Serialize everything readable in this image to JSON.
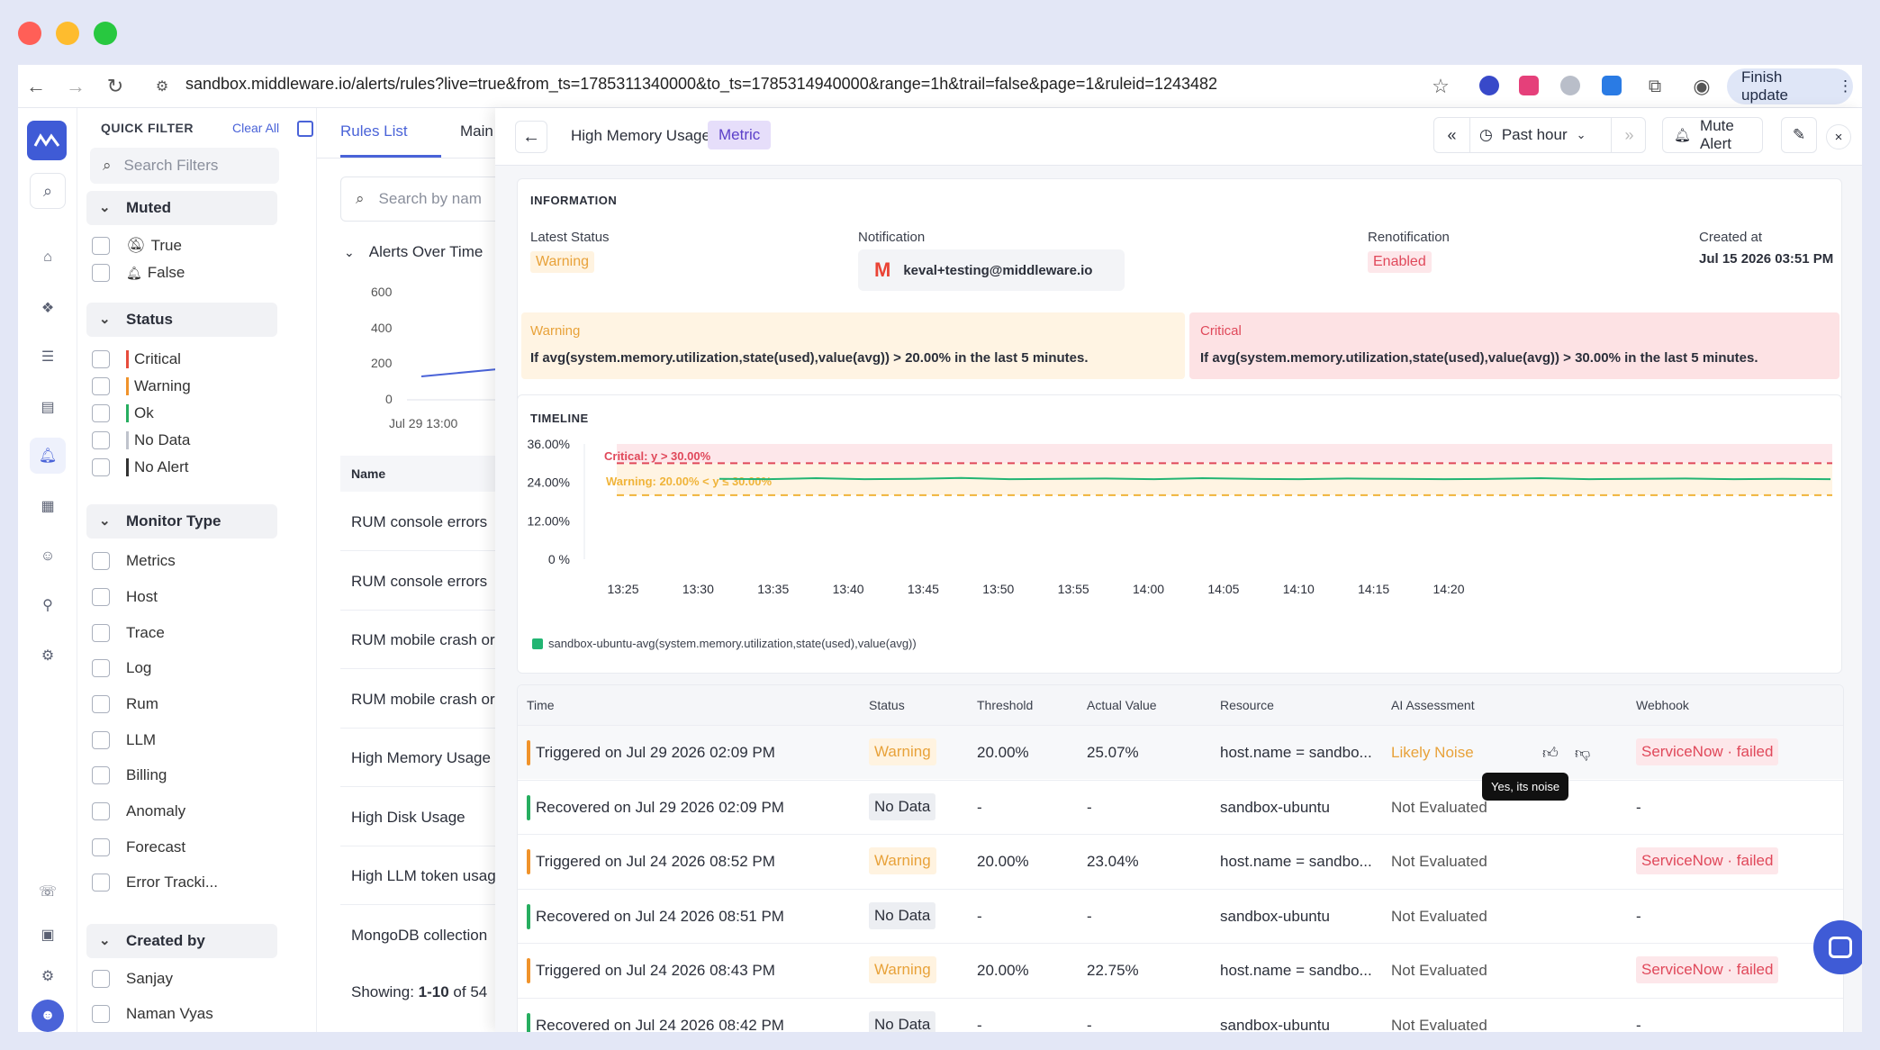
{
  "browser": {
    "url": "sandbox.middleware.io/alerts/rules?live=true&from_ts=1785311340000&to_ts=1785314940000&range=1h&trail=false&page=1&ruleid=1243482",
    "finish_update": "Finish update"
  },
  "quick_filter": {
    "title": "QUICK FILTER",
    "clear_all": "Clear All",
    "search_placeholder": "Search Filters",
    "muted": {
      "title": "Muted",
      "options": [
        "True",
        "False"
      ]
    },
    "status": {
      "title": "Status",
      "options": [
        "Critical",
        "Warning",
        "Ok",
        "No Data",
        "No Alert"
      ]
    },
    "monitor_type": {
      "title": "Monitor Type",
      "options": [
        "Metrics",
        "Host",
        "Trace",
        "Log",
        "Rum",
        "LLM",
        "Billing",
        "Anomaly",
        "Forecast",
        "Error Tracki..."
      ]
    },
    "created_by": {
      "title": "Created by",
      "options": [
        "Sanjay",
        "Naman Vyas"
      ]
    }
  },
  "rules_list": {
    "tabs": [
      "Rules List",
      "Main"
    ],
    "search_placeholder": "Search by nam",
    "alerts_over_time": "Alerts Over Time",
    "y_ticks": [
      "600",
      "400",
      "200",
      "0"
    ],
    "x_tick": "Jul 29 13:00",
    "name_header": "Name",
    "rows": [
      "RUM console errors",
      "RUM console errors",
      "RUM mobile crash or",
      "RUM mobile crash or",
      "High Memory Usage",
      "High Disk Usage",
      "High LLM token usag",
      "MongoDB collection"
    ],
    "showing_prefix": "Showing: ",
    "showing_range": "1-10",
    "showing_suffix": " of 54"
  },
  "detail": {
    "title": "High Memory Usage",
    "type_badge": "Metric",
    "time_range": "Past hour",
    "mute_label": "Mute Alert",
    "info_title": "INFORMATION",
    "latest_status_label": "Latest Status",
    "latest_status": "Warning",
    "notification_label": "Notification",
    "notification_email": "keval+testing@middleware.io",
    "renotification_label": "Renotification",
    "renotification": "Enabled",
    "created_at_label": "Created at",
    "created_at": "Jul 15 2026 03:51 PM",
    "warning_title": "Warning",
    "warning_condition": "If avg(system.memory.utilization,state(used),value(avg)) > 20.00% in the last 5 minutes.",
    "critical_title": "Critical",
    "critical_condition": "If avg(system.memory.utilization,state(used),value(avg)) > 30.00% in the last 5 minutes."
  },
  "chart_data": {
    "type": "line",
    "title": "TIMELINE",
    "y_ticks": [
      "36.00%",
      "24.00%",
      "12.00%",
      "0 %"
    ],
    "ylim": [
      0,
      36
    ],
    "x": [
      "13:25",
      "13:30",
      "13:35",
      "13:40",
      "13:45",
      "13:50",
      "13:55",
      "14:00",
      "14:05",
      "14:10",
      "14:15",
      "14:20"
    ],
    "thresholds": {
      "critical_label": "Critical: y > 30.00%",
      "critical": 30,
      "warning_label": "Warning: 20.00% < y ≤ 30.00%",
      "warning": 20
    },
    "series": [
      {
        "name": "sandbox-ubuntu-avg(system.memory.utilization,state(used),value(avg))",
        "color": "#22b573",
        "values": [
          25.1,
          25.0,
          25.3,
          25.0,
          25.1,
          25.4,
          25.0,
          25.1,
          25.2,
          25.0,
          25.3,
          25.1,
          25.0,
          25.2,
          25.1,
          25.0,
          25.1,
          25.3,
          25.0,
          25.1,
          25.2,
          25.0,
          25.1,
          25.0
        ]
      }
    ]
  },
  "table": {
    "headers": [
      "Time",
      "Status",
      "Threshold",
      "Actual Value",
      "Resource",
      "AI Assessment",
      "",
      "Webhook"
    ],
    "rows": [
      {
        "time": "Triggered on Jul 29 2026 02:09 PM",
        "status": "Warning",
        "threshold": "20.00%",
        "actual": "25.07%",
        "resource": "host.name = sandbo...",
        "ai": "Likely Noise",
        "webhook": "ServiceNow · failed",
        "bar": "#f0932b"
      },
      {
        "time": "Recovered on Jul 29 2026 02:09 PM",
        "status": "No Data",
        "threshold": "-",
        "actual": "-",
        "resource": "sandbox-ubuntu",
        "ai": "Not Evaluated",
        "webhook": "-",
        "bar": "#27ae60"
      },
      {
        "time": "Triggered on Jul 24 2026 08:52 PM",
        "status": "Warning",
        "threshold": "20.00%",
        "actual": "23.04%",
        "resource": "host.name = sandbo...",
        "ai": "Not Evaluated",
        "webhook": "ServiceNow · failed",
        "bar": "#f0932b"
      },
      {
        "time": "Recovered on Jul 24 2026 08:51 PM",
        "status": "No Data",
        "threshold": "-",
        "actual": "-",
        "resource": "sandbox-ubuntu",
        "ai": "Not Evaluated",
        "webhook": "-",
        "bar": "#27ae60"
      },
      {
        "time": "Triggered on Jul 24 2026 08:43 PM",
        "status": "Warning",
        "threshold": "20.00%",
        "actual": "22.75%",
        "resource": "host.name = sandbo...",
        "ai": "Not Evaluated",
        "webhook": "ServiceNow · failed",
        "bar": "#f0932b"
      },
      {
        "time": "Recovered on Jul 24 2026 08:42 PM",
        "status": "No Data",
        "threshold": "-",
        "actual": "-",
        "resource": "sandbox-ubuntu",
        "ai": "Not Evaluated",
        "webhook": "-",
        "bar": "#27ae60"
      }
    ],
    "tooltip": "Yes, its noise"
  }
}
